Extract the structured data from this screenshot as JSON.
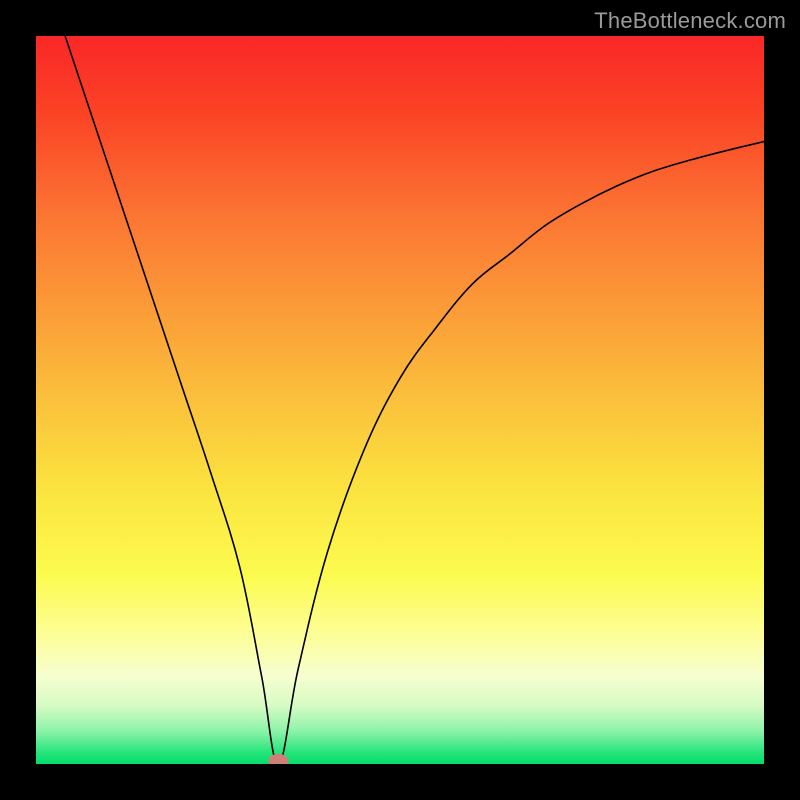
{
  "watermark": "TheBottleneck.com",
  "chart_data": {
    "type": "line",
    "title": "",
    "xlabel": "",
    "ylabel": "",
    "xlim": [
      0,
      100
    ],
    "ylim": [
      0,
      100
    ],
    "grid": false,
    "legend": false,
    "notes": "V-shaped bottleneck curve: value falls steeply to a minimum near x≈33, y≈0, then rises with decreasing slope. Background is a vertical spectrum gradient from green (bottom) through yellow/orange to red (top). A small pinkish marker sits at the curve minimum.",
    "series": [
      {
        "name": "bottleneck-curve",
        "x": [
          4,
          8,
          12,
          16,
          20,
          24,
          28,
          31,
          33.3,
          36,
          40,
          45,
          50,
          55,
          60,
          65,
          70,
          75,
          80,
          85,
          90,
          95,
          100
        ],
        "values": [
          100,
          88,
          76,
          64,
          52,
          40,
          27,
          12,
          0,
          13,
          29,
          43,
          53,
          60,
          66,
          70,
          74,
          77,
          79.5,
          81.5,
          83,
          84.3,
          85.5
        ]
      }
    ],
    "marker": {
      "x": 33.3,
      "y": 0,
      "rx": 1.4,
      "ry": 1.0,
      "fill": "#cf8076"
    },
    "gradient_stops": [
      {
        "offset": 0.0,
        "color": "#fa2727"
      },
      {
        "offset": 0.1,
        "color": "#fb4125"
      },
      {
        "offset": 0.25,
        "color": "#fb7633"
      },
      {
        "offset": 0.45,
        "color": "#fbb23a"
      },
      {
        "offset": 0.62,
        "color": "#fbe33f"
      },
      {
        "offset": 0.74,
        "color": "#fcfb4f"
      },
      {
        "offset": 0.82,
        "color": "#fdfe95"
      },
      {
        "offset": 0.88,
        "color": "#f6fed0"
      },
      {
        "offset": 0.92,
        "color": "#d6fbc3"
      },
      {
        "offset": 0.955,
        "color": "#8cf3a9"
      },
      {
        "offset": 0.985,
        "color": "#23e47a"
      },
      {
        "offset": 1.0,
        "color": "#04dd6a"
      }
    ]
  }
}
